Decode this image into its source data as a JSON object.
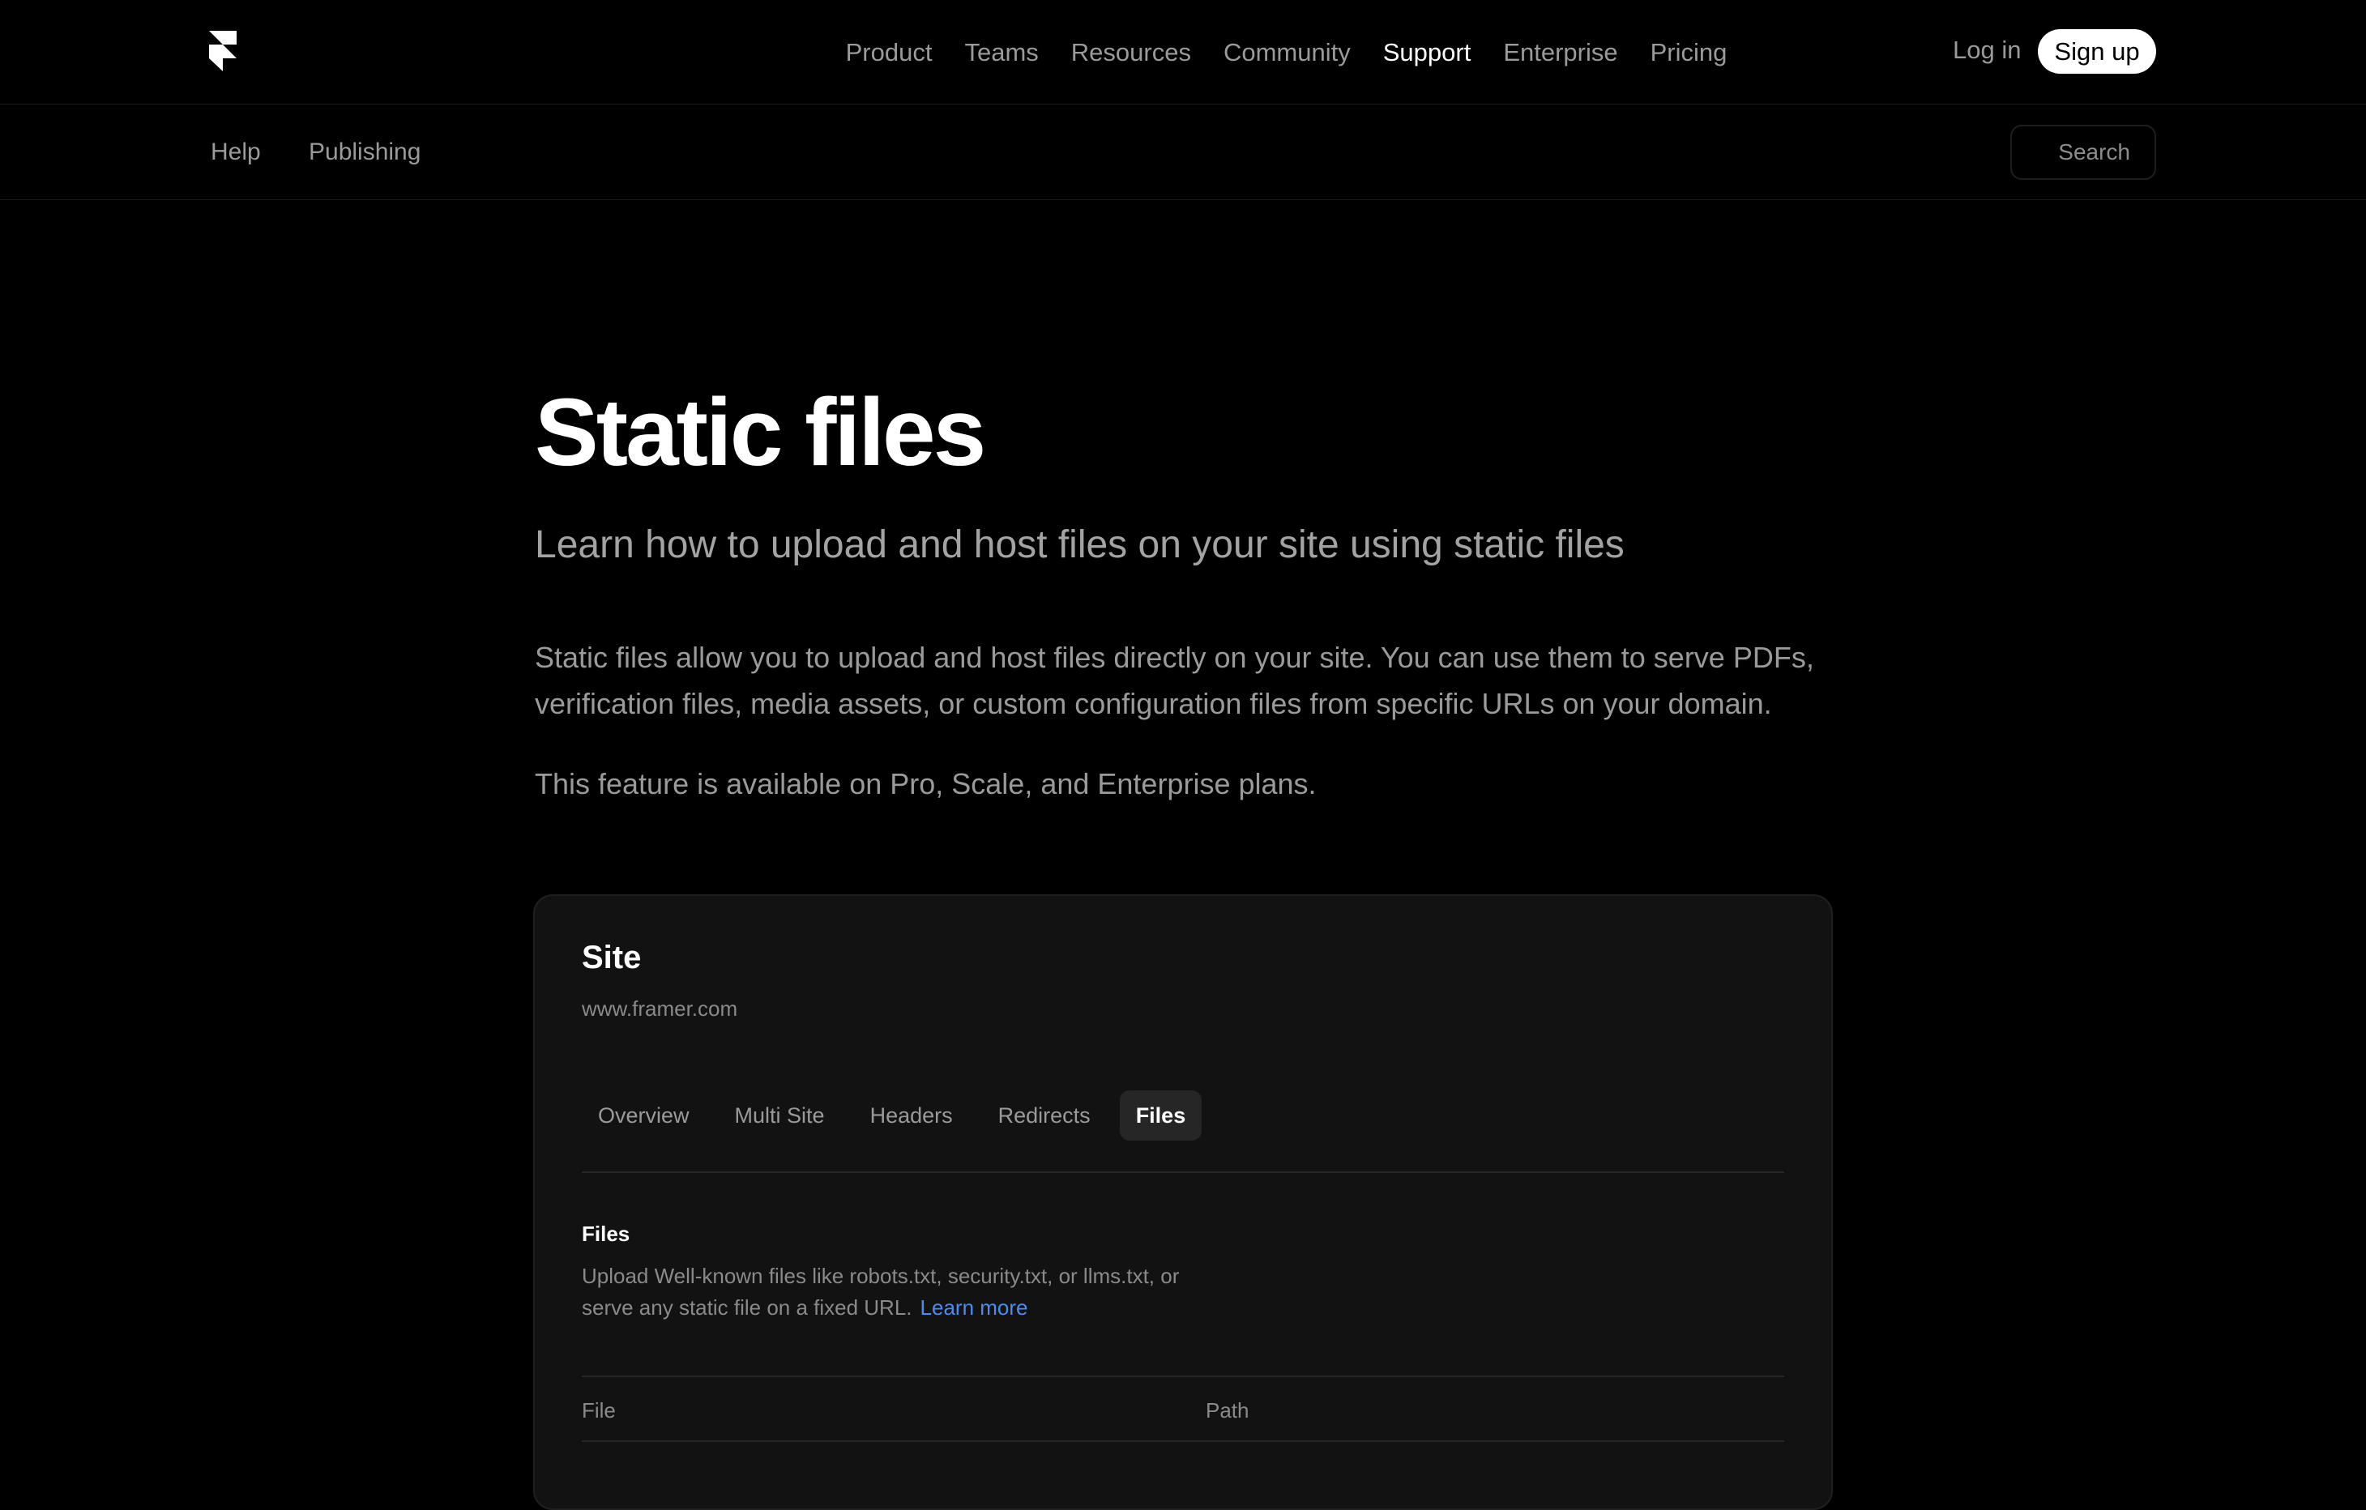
{
  "nav": {
    "items": [
      {
        "label": "Product",
        "active": false
      },
      {
        "label": "Teams",
        "active": false
      },
      {
        "label": "Resources",
        "active": false
      },
      {
        "label": "Community",
        "active": false
      },
      {
        "label": "Support",
        "active": true
      },
      {
        "label": "Enterprise",
        "active": false
      },
      {
        "label": "Pricing",
        "active": false
      }
    ],
    "login_label": "Log in",
    "signup_label": "Sign up"
  },
  "subnav": {
    "breadcrumb": [
      "Help",
      "Publishing"
    ],
    "search_label": "Search"
  },
  "article": {
    "title": "Static files",
    "lead": "Learn how to upload and host files on your site using static files",
    "paragraph1": "Static files allow you to upload and host files directly on your site. You can use them to serve PDFs, verification files, media assets, or custom configuration files from specific URLs on your domain.",
    "paragraph2": "This feature is available on Pro, Scale, and Enterprise plans."
  },
  "card": {
    "site_title": "Site",
    "site_url": "www.framer.com",
    "tabs": [
      {
        "label": "Overview",
        "active": false
      },
      {
        "label": "Multi Site",
        "active": false
      },
      {
        "label": "Headers",
        "active": false
      },
      {
        "label": "Redirects",
        "active": false
      },
      {
        "label": "Files",
        "active": true
      }
    ],
    "files_heading": "Files",
    "files_description": "Upload Well-known files like robots.txt, security.txt, or llms.txt, or serve any static file on a fixed URL.",
    "learn_more": "Learn more",
    "columns": [
      "File",
      "Path"
    ]
  },
  "colors": {
    "background": "#000000",
    "card_background": "#121212",
    "link": "#4a8cf0"
  },
  "icons": {
    "logo": "framer-logo-icon"
  }
}
